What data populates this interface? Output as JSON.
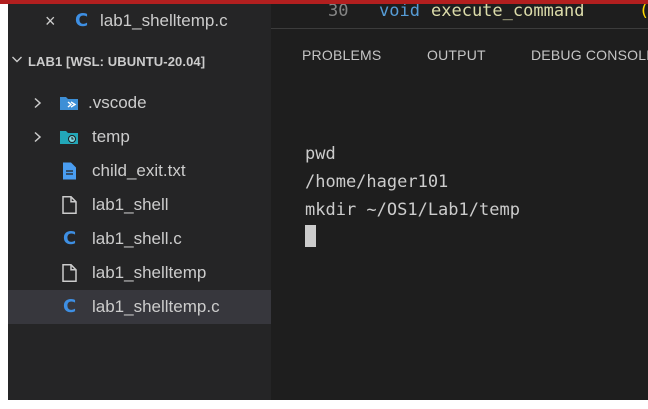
{
  "open_editor": {
    "close_glyph": "×",
    "file_type_glyph": "C",
    "file_name": "lab1_shelltemp.c"
  },
  "explorer": {
    "folder_title": "LAB1 [WSL: UBUNTU-20.04]",
    "items": [
      {
        "label": ".vscode",
        "kind": "folder",
        "icon": "vscode-folder-icon"
      },
      {
        "label": "temp",
        "kind": "folder",
        "icon": "temp-folder-icon"
      },
      {
        "label": "child_exit.txt",
        "kind": "file",
        "icon": "text-file-icon"
      },
      {
        "label": "lab1_shell",
        "kind": "file",
        "icon": "file-icon"
      },
      {
        "label": "lab1_shell.c",
        "kind": "file",
        "icon": "c-file-icon",
        "glyph": "C"
      },
      {
        "label": "lab1_shelltemp",
        "kind": "file",
        "icon": "file-icon"
      },
      {
        "label": "lab1_shelltemp.c",
        "kind": "file",
        "icon": "c-file-icon",
        "glyph": "C",
        "selected": true
      }
    ]
  },
  "editor": {
    "line_number": "30",
    "keyword": "void",
    "function_name": "execute_command",
    "open_paren": "("
  },
  "panel": {
    "tabs": [
      "PROBLEMS",
      "OUTPUT",
      "DEBUG CONSOLE"
    ]
  },
  "terminal": {
    "lines": [
      "pwd",
      "/home/hager101",
      "mkdir ~/OS1/Lab1/temp"
    ]
  },
  "colors": {
    "accent_red": "#b21f1f",
    "c_icon_blue": "#3e8fe3",
    "sidebar_bg": "#252526",
    "editor_bg": "#1e1e1e",
    "selection_bg": "#37373d"
  }
}
